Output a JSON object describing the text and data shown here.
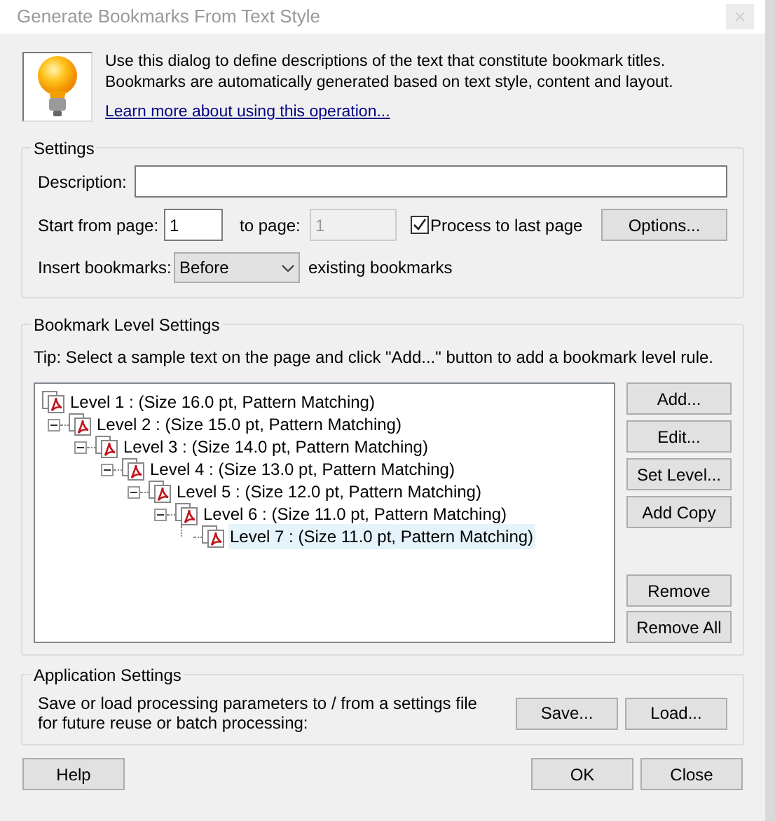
{
  "window": {
    "title": "Generate Bookmarks From Text Style"
  },
  "intro": {
    "text": "Use this dialog to define descriptions of the text that constitute bookmark titles. Bookmarks are automatically generated based on text style, content and layout.",
    "link": "Learn more about using this operation..."
  },
  "settings": {
    "title": "Settings",
    "description_label": "Description:",
    "start_label": "Start from page:",
    "start_value": "1",
    "to_label": "to page:",
    "to_value": "1",
    "to_disabled": true,
    "process_label": "Process to last page",
    "process_checked": true,
    "options_button": "Options...",
    "insert_label": "Insert bookmarks:",
    "insert_value": "Before",
    "insert_suffix": "existing bookmarks"
  },
  "levels": {
    "title": "Bookmark Level Settings",
    "tip": "Tip: Select a sample text on the page and click \"Add...\" button to add a bookmark level rule.",
    "tree": [
      {
        "label": "Level 1 : (Size 16.0 pt, Pattern Matching)",
        "selected": false,
        "children": [
          {
            "label": "Level 2 : (Size 15.0 pt, Pattern Matching)",
            "selected": false,
            "children": [
              {
                "label": "Level 3 : (Size 14.0 pt, Pattern Matching)",
                "selected": false,
                "children": [
                  {
                    "label": "Level 4 : (Size 13.0 pt, Pattern Matching)",
                    "selected": false,
                    "children": [
                      {
                        "label": "Level 5 : (Size 12.0 pt, Pattern Matching)",
                        "selected": false,
                        "children": [
                          {
                            "label": "Level 6 : (Size 11.0 pt, Pattern Matching)",
                            "selected": false,
                            "children": [
                              {
                                "label": "Level 7 : (Size 11.0 pt, Pattern Matching)",
                                "selected": true
                              }
                            ]
                          }
                        ]
                      }
                    ]
                  }
                ]
              }
            ]
          }
        ]
      }
    ],
    "top_buttons": [
      "Add...",
      "Edit...",
      "Set Level...",
      "Add Copy"
    ],
    "bottom_buttons": [
      "Remove",
      "Remove All"
    ]
  },
  "app_settings": {
    "title": "Application Settings",
    "text": "Save or load processing parameters to / from a settings file for future reuse or batch processing:",
    "buttons": [
      "Save...",
      "Load..."
    ]
  },
  "footer": {
    "help": "Help",
    "ok": "OK",
    "close": "Close"
  }
}
